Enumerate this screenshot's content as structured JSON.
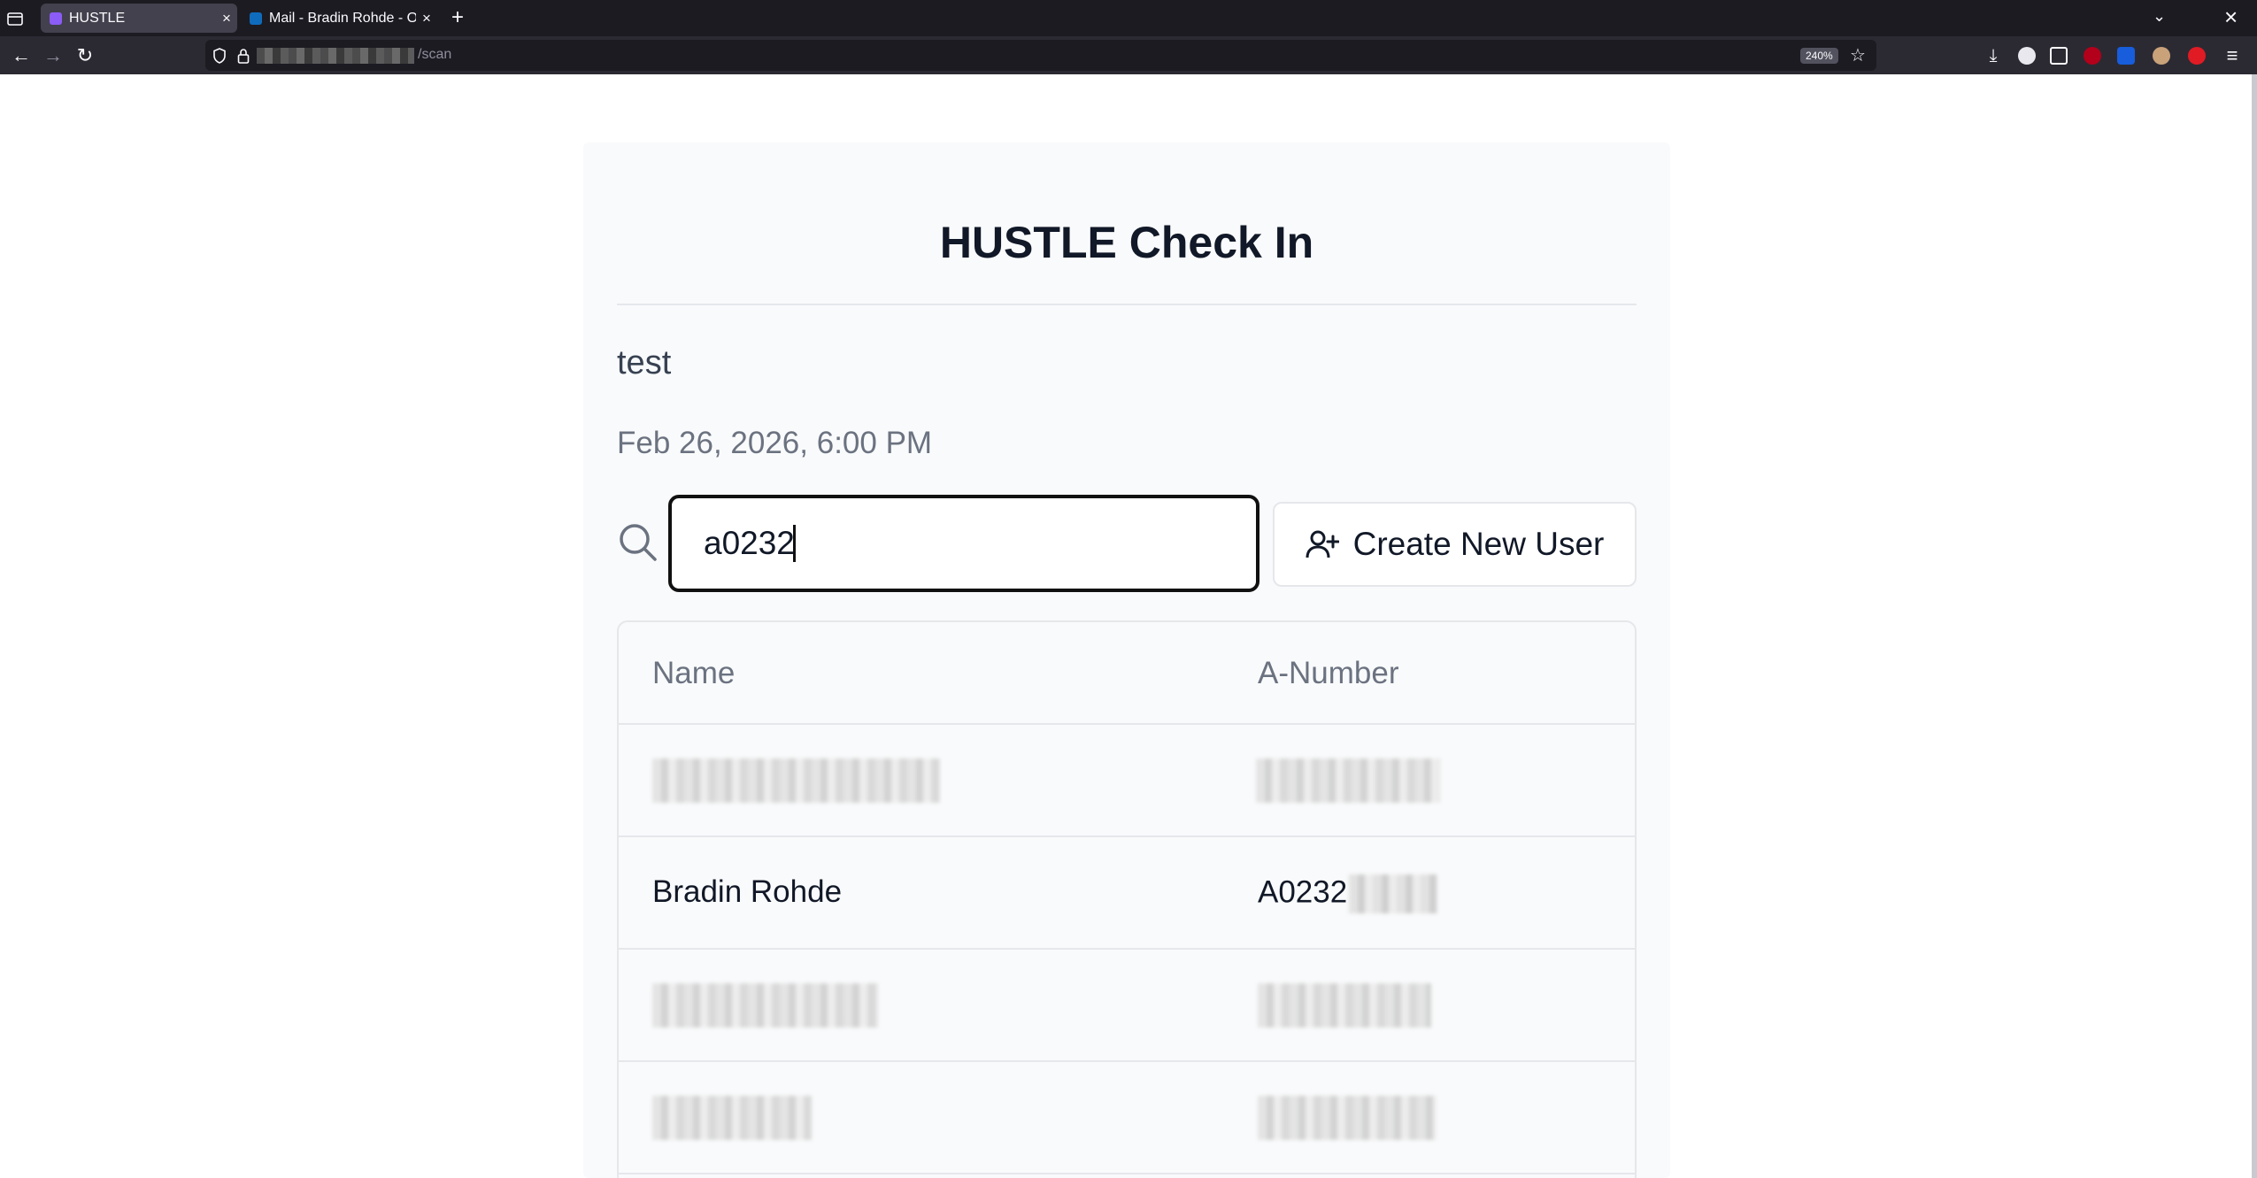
{
  "browser": {
    "tabs": [
      {
        "title": "HUSTLE",
        "active": true,
        "favicon_color": "#8b5cf6"
      },
      {
        "title": "Mail - Bradin Rohde - Out",
        "active": false,
        "favicon_color": "#0f6cbd"
      }
    ],
    "url_path": "/scan",
    "zoom": "240%"
  },
  "page": {
    "title": "HUSTLE Check In",
    "event_name": "test",
    "event_date": "Feb 26, 2026, 6:00 PM",
    "search": {
      "value": "a0232",
      "icon": "search-icon"
    },
    "create_button": {
      "label": "Create New User",
      "icon": "user-plus-icon"
    }
  },
  "table": {
    "headers": {
      "name": "Name",
      "a_number": "A-Number"
    },
    "rows": [
      {
        "name": "",
        "a_number_prefix": "",
        "redacted": true
      },
      {
        "name": "Bradin Rohde",
        "a_number_prefix": "A0232",
        "redacted": false
      },
      {
        "name": "",
        "a_number_prefix": "",
        "redacted": true
      },
      {
        "name": "",
        "a_number_prefix": "",
        "redacted": true
      }
    ]
  },
  "colors": {
    "title": "#111827",
    "muted": "#6b7280",
    "border": "#e5e7eb",
    "card_bg": "#f9fafb"
  }
}
